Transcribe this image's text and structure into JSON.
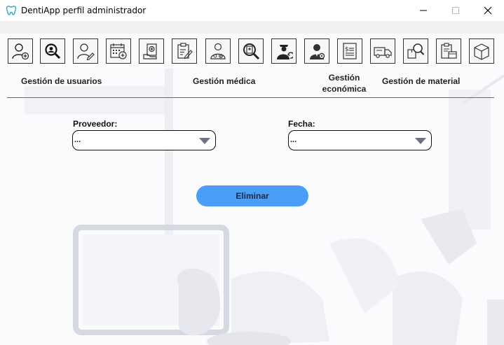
{
  "window": {
    "title": "DentiApp perfil administrador",
    "icon": "tooth-icon",
    "controls": [
      "minimize",
      "maximize",
      "close"
    ]
  },
  "toolbar": {
    "buttons": [
      {
        "name": "add-user",
        "icon": "user-add-icon"
      },
      {
        "name": "search-user",
        "icon": "user-search-icon"
      },
      {
        "name": "edit-user",
        "icon": "user-edit-icon"
      },
      {
        "name": "calendar-add",
        "icon": "calendar-add-icon"
      },
      {
        "name": "medical-folder",
        "icon": "medical-folder-icon"
      },
      {
        "name": "edit-document",
        "icon": "document-edit-icon"
      },
      {
        "name": "doctor",
        "icon": "doctor-icon"
      },
      {
        "name": "search-medical",
        "icon": "medical-search-icon"
      },
      {
        "name": "staff-swap",
        "icon": "staff-swap-icon"
      },
      {
        "name": "staff-settings",
        "icon": "staff-settings-icon"
      },
      {
        "name": "invoice",
        "icon": "invoice-icon"
      },
      {
        "name": "delivery-truck",
        "icon": "truck-icon"
      },
      {
        "name": "search-box",
        "icon": "box-search-icon"
      },
      {
        "name": "inventory",
        "icon": "inventory-icon"
      },
      {
        "name": "package",
        "icon": "package-icon"
      }
    ]
  },
  "sections": {
    "users": "Gestión de usuarios",
    "medical": "Gestión médica",
    "economic_line1": "Gestión",
    "economic_line2": "económica",
    "material": "Gestión de material"
  },
  "form": {
    "supplier_label": "Proveedor:",
    "supplier_value": "...",
    "date_label": "Fecha:",
    "date_value": "...",
    "delete_button": "Eliminar"
  },
  "colors": {
    "accent_button": "#4a9ef7",
    "divider": "#5a6b86",
    "app_icon": "#2bb3c0"
  }
}
